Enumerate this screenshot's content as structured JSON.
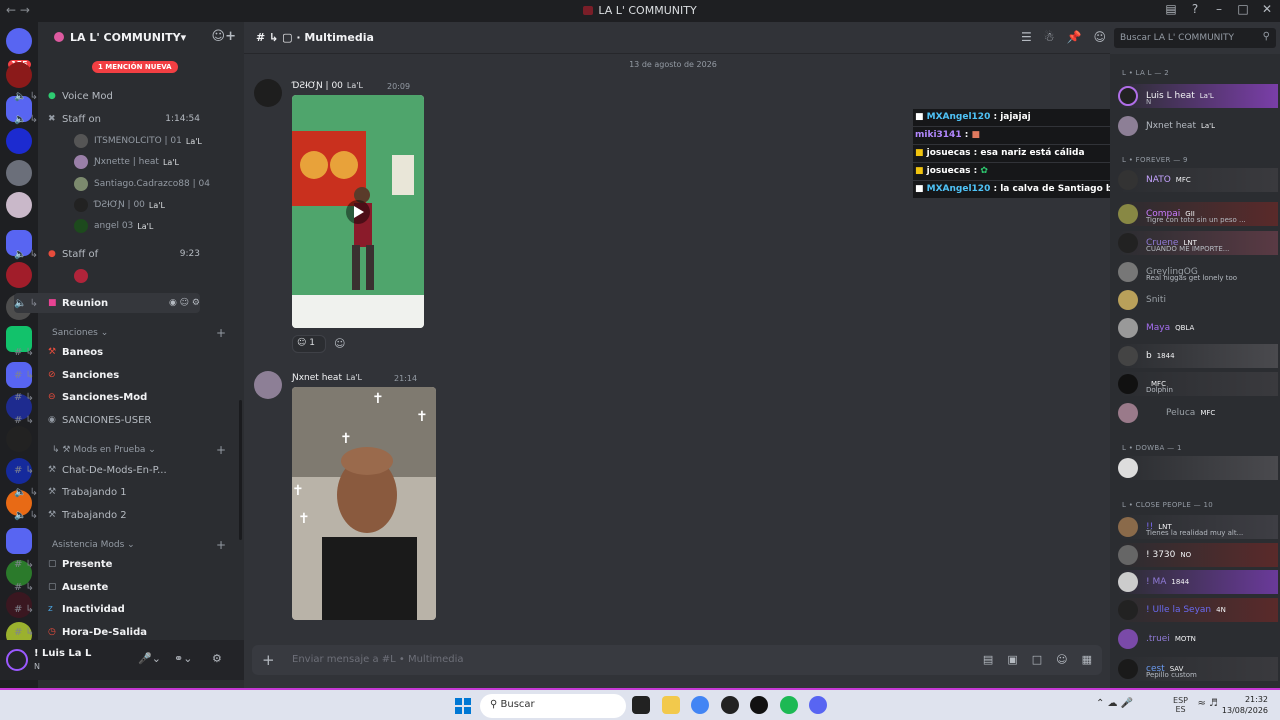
{
  "window": {
    "title": "LA L' COMMUNITY"
  },
  "servers": {
    "badge": "155"
  },
  "guild": {
    "name": "LA L' COMMUNITY"
  },
  "mention_pill": "1 MENCIÓN NUEVA",
  "channels": {
    "top": [
      {
        "name": "Voice Mod",
        "meta": ""
      },
      {
        "name": "Staff on",
        "meta": "1:14:54"
      }
    ],
    "voice_users": [
      {
        "name": "ITSMENOLCITO | 01",
        "tag": "La'L"
      },
      {
        "name": "Ɲxnette | heat",
        "tag": "La'L"
      },
      {
        "name": "Santiago.Cadrazco88 | 04",
        "tag": ""
      },
      {
        "name": "ƊƧƗƠƝ | 00",
        "tag": "La'L"
      },
      {
        "name": "angel 03",
        "tag": "La'L"
      }
    ],
    "staff_of": {
      "name": "Staff of",
      "meta": "9:23"
    },
    "reunion": {
      "name": "Reunion"
    },
    "cat_sanciones": "Sanciones",
    "sanciones": [
      "Baneos",
      "Sanciones",
      "Sanciones-Mod",
      "SANCIONES-USER"
    ],
    "cat_mods": "Mods en Prueba",
    "mods": [
      "Chat-De-Mods-En-P...",
      "Trabajando 1",
      "Trabajando 2"
    ],
    "cat_asistencia": "Asistencia Mods",
    "asistencia": [
      "Presente",
      "Ausente",
      "Inactividad",
      "Hora-De-Salida"
    ]
  },
  "userbar": {
    "name": "! Luis La L",
    "status": "N"
  },
  "header": {
    "channel": "Multimedia"
  },
  "search": {
    "placeholder": "Buscar LA L' COMMUNITY"
  },
  "chat": {
    "date": "13 de agosto de 2026",
    "messages": [
      {
        "author": "ƊƧƗƠƝ | 00",
        "tag": "La'L",
        "time": "20:09",
        "reaction": "1"
      },
      {
        "author": "Ɲxnet   heat",
        "tag": "La'L",
        "time": "21:14"
      }
    ]
  },
  "overlay": [
    {
      "user": "MXAngel120",
      "text": " : jajajaj"
    },
    {
      "user": "miki3141",
      "text": " : "
    },
    {
      "user": "josuecas",
      "text": " : esa nariz está cálida"
    },
    {
      "user": "josuecas",
      "text": " : "
    },
    {
      "user": "MXAngel120",
      "text": " : la calva de Santiago brilla como una canica pa"
    }
  ],
  "members": {
    "groups": [
      {
        "label": "L • LA L — 2"
      },
      {
        "label": "L • FOREVER — 9"
      },
      {
        "label": "L • DOWBA — 1"
      },
      {
        "label": "L • CLOSE PEOPLE — 10"
      }
    ],
    "list": [
      {
        "name": "Luis L   heat",
        "tag": "La'L",
        "sub": "N"
      },
      {
        "name": "Ɲxnet   heat",
        "tag": "La'L",
        "sub": ""
      },
      {
        "name": "Compai",
        "tag": "GII",
        "sub": "Tigre con toto sin un peso ..."
      },
      {
        "name": "Cruene",
        "tag": "LNT",
        "sub": "CUANDO ME IMPORTE..."
      },
      {
        "name": "GreylingOG",
        "tag": "",
        "sub": "Real niggas get lonely too"
      },
      {
        "name": "Sniti",
        "tag": "",
        "sub": ""
      },
      {
        "name": "Maya",
        "tag": "QBLA",
        "sub": ""
      },
      {
        "name": "b",
        "tag": "1844",
        "sub": ""
      },
      {
        "name": "",
        "tag": "MFC",
        "sub": "Dolphin"
      },
      {
        "name": "Peluca",
        "tag": "MFC",
        "sub": ""
      },
      {
        "name": "",
        "tag": "",
        "sub": ""
      },
      {
        "name": "",
        "tag": "LNT",
        "sub": "Tienes la realidad muy alt..."
      },
      {
        "name": "! 3730",
        "tag": "NO",
        "sub": ""
      },
      {
        "name": "! MA",
        "tag": "1844",
        "sub": ""
      },
      {
        "name": "! Ulle la Seyan",
        "tag": "4N",
        "sub": ""
      },
      {
        "name": ".truei",
        "tag": "MOTN",
        "sub": ""
      },
      {
        "name": "cest",
        "tag": "SAV",
        "sub": "Pepillo custom"
      }
    ]
  },
  "composer": {
    "placeholder": "Enviar mensaje a #L • Multimedia"
  },
  "taskbar": {
    "search": "Buscar",
    "lang1": "ESP",
    "lang2": "ES",
    "time": "21:32",
    "date": "13/08/2026"
  }
}
